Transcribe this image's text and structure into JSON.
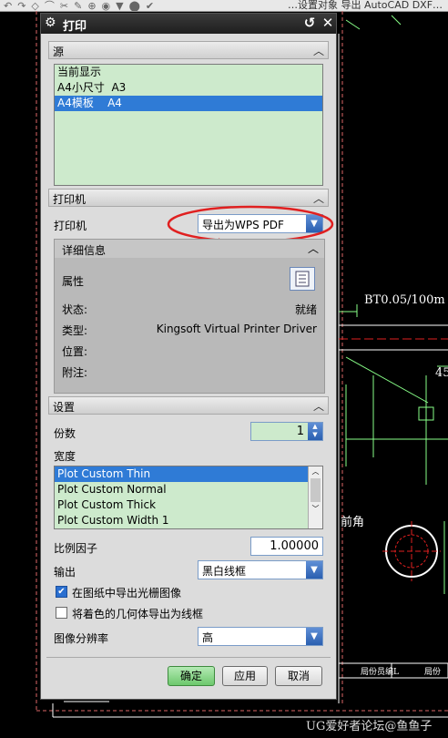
{
  "toolbar": {
    "partial_title": "…设置对象 导出 AutoCAD DXF…"
  },
  "dialog": {
    "title": "打印",
    "source": {
      "header": "源",
      "items": [
        "当前显示",
        "A4小尺寸  A3",
        "A4模板    A4"
      ],
      "selected_index": 2
    },
    "printer_section": {
      "header": "打印机",
      "printer_label": "打印机",
      "printer_value": "导出为WPS PDF",
      "details": {
        "header": "详细信息",
        "properties_label": "属性",
        "status_label": "状态:",
        "status_value": "就绪",
        "type_label": "类型:",
        "type_value": "Kingsoft Virtual Printer Driver",
        "location_label": "位置:",
        "comment_label": "附注:"
      }
    },
    "settings": {
      "header": "设置",
      "copies_label": "份数",
      "copies_value": "1",
      "width_label": "宽度",
      "width_items": [
        "Plot Custom Thin",
        "Plot Custom Normal",
        "Plot Custom Thick",
        "Plot Custom Width 1"
      ],
      "width_selected_index": 0,
      "scale_label": "比例因子",
      "scale_value": "1.00000",
      "output_label": "输出",
      "output_value": "黑白线框",
      "raster_checkbox_label": "在图纸中导出光栅图像",
      "raster_checked": true,
      "wireframe_checkbox_label": "将着色的几何体导出为线框",
      "wireframe_checked": false,
      "resolution_label": "图像分辨率",
      "resolution_value": "高"
    },
    "buttons": {
      "ok": "确定",
      "apply": "应用",
      "cancel": "取消"
    }
  },
  "cad": {
    "tolerance": "BT0.05/100m",
    "angle": "45",
    "chamfer": "前角",
    "table_cell_1": "局份员编L",
    "table_cell_2": "局份",
    "watermark": "UG爱好者论坛@鱼鱼子"
  },
  "colors": {
    "accent_red": "#e02020",
    "list_green": "#cdeacc",
    "selection_blue": "#2f7bd6"
  }
}
